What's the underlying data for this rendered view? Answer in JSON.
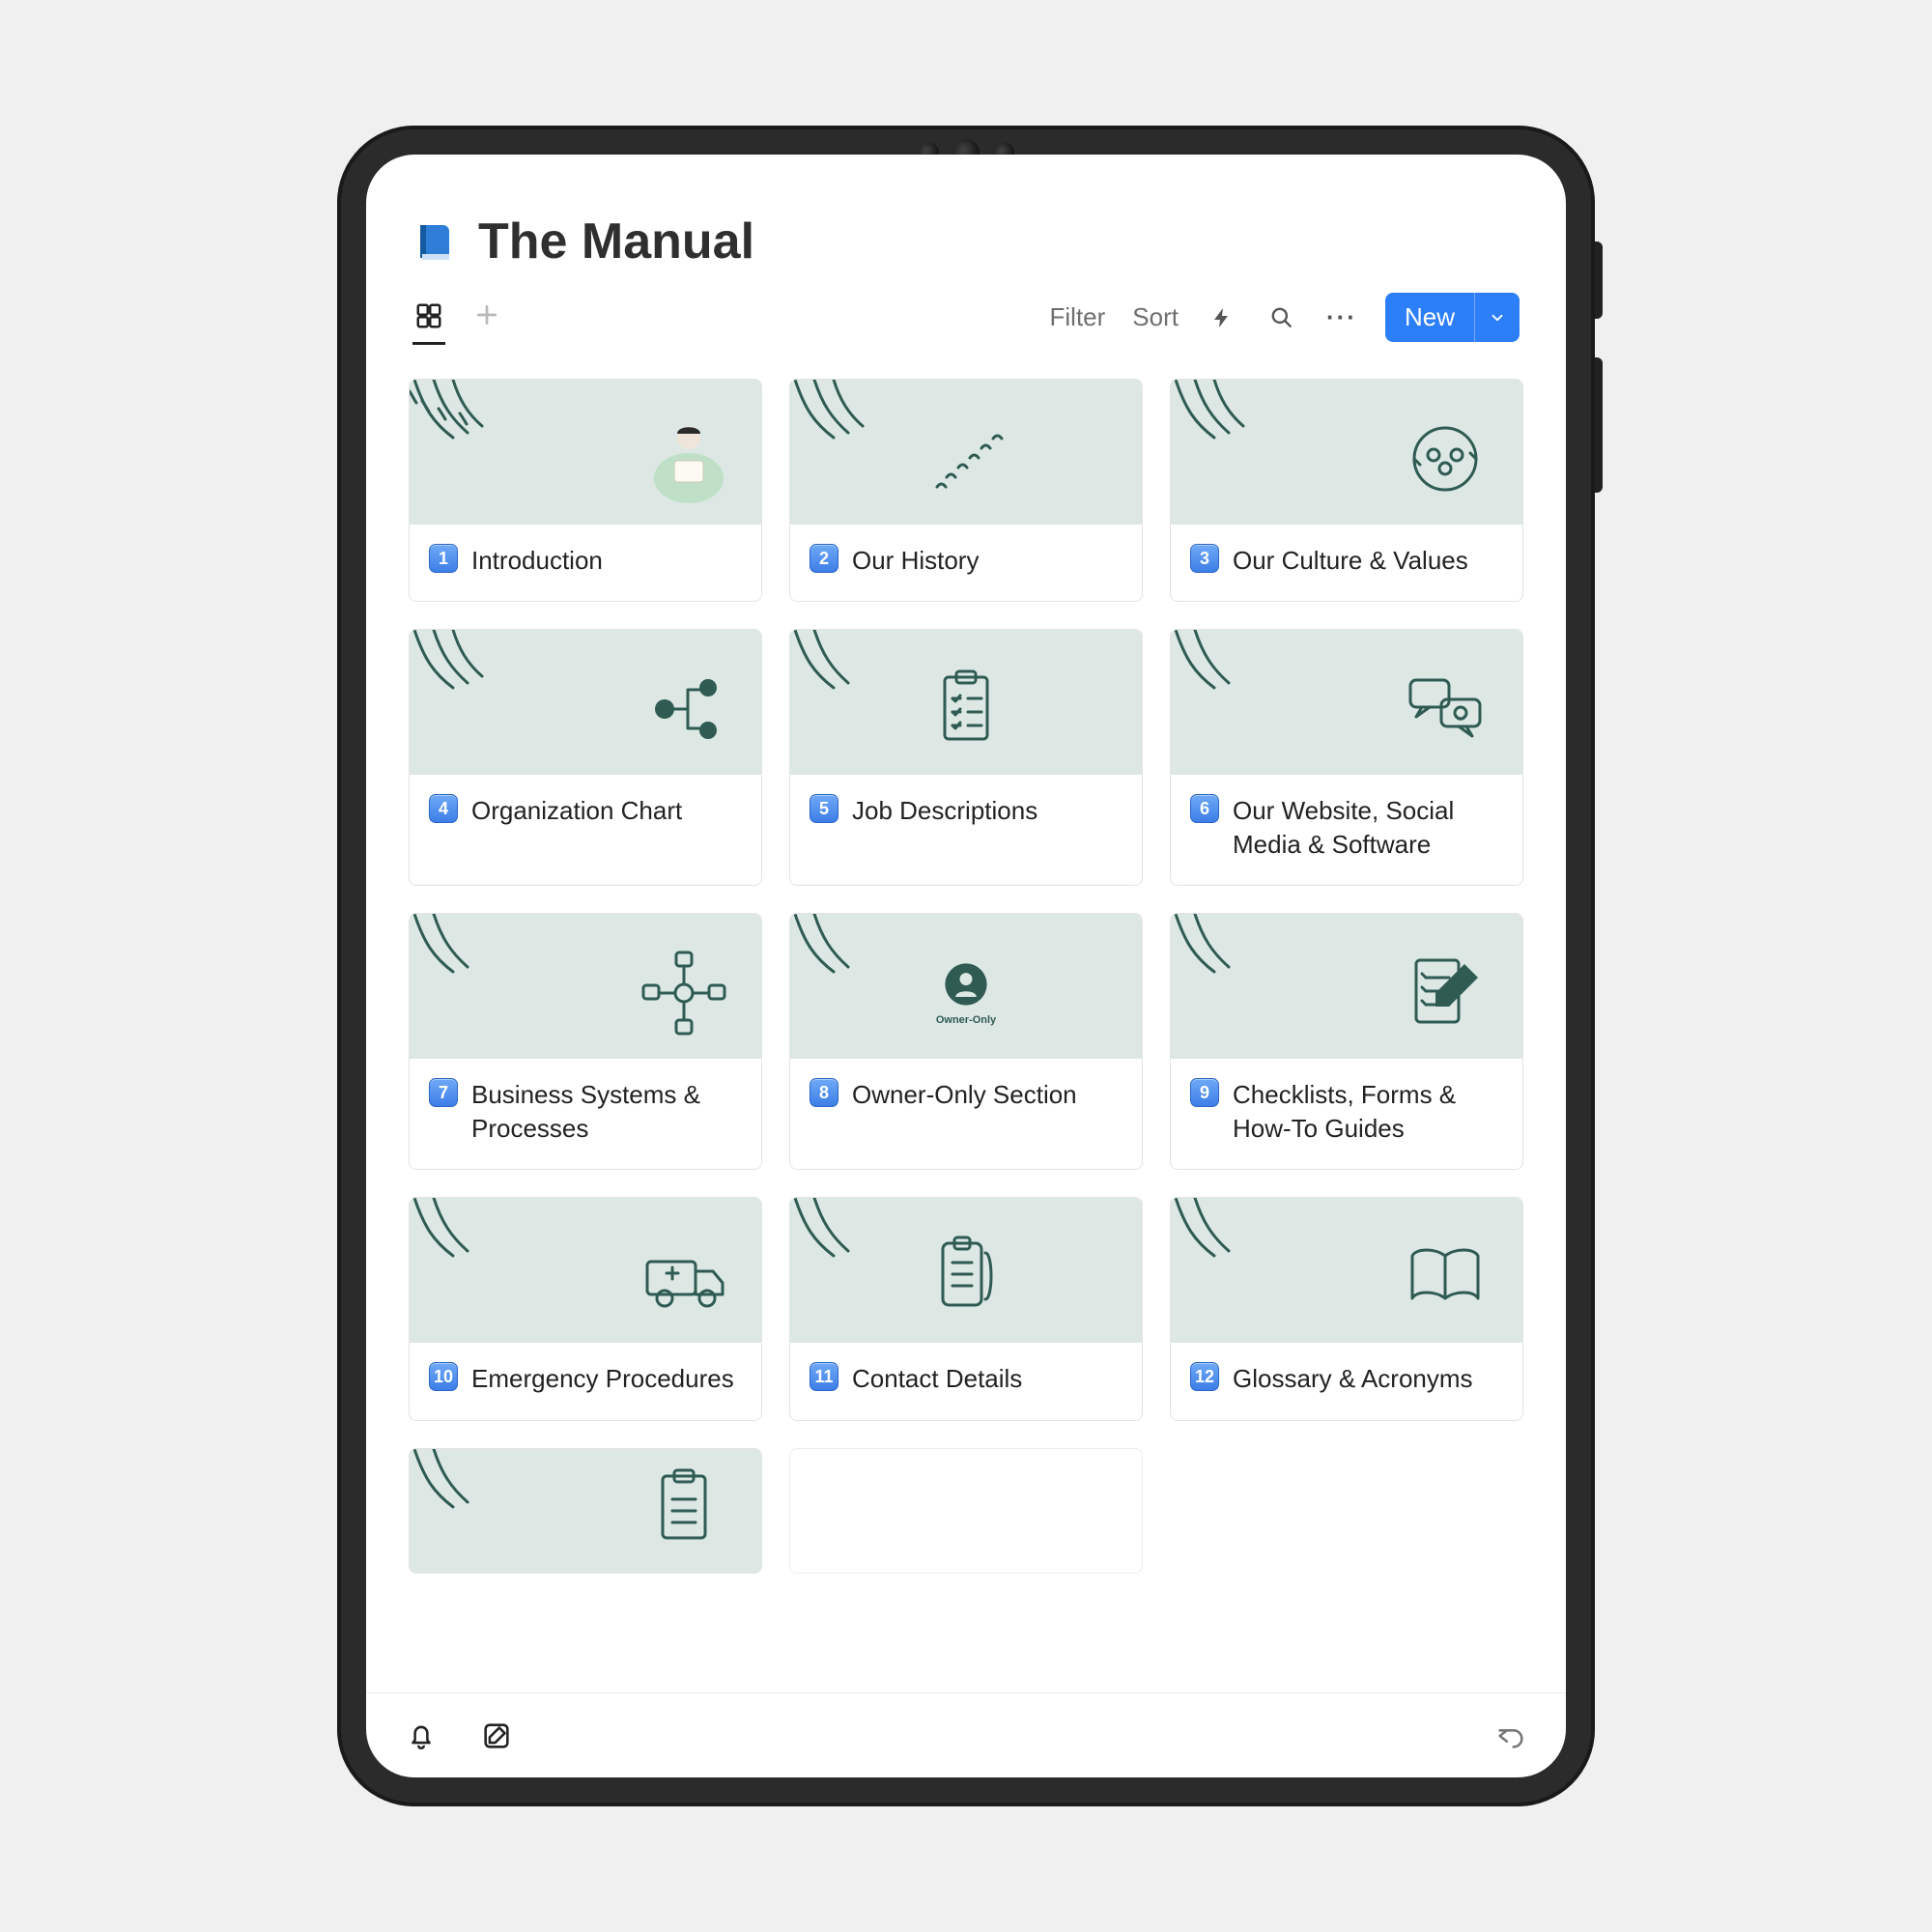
{
  "page_title": "The Manual",
  "toolbar": {
    "filter_label": "Filter",
    "sort_label": "Sort",
    "new_label": "New"
  },
  "cards": [
    {
      "num": "1",
      "title": "Introduction"
    },
    {
      "num": "2",
      "title": "Our History"
    },
    {
      "num": "3",
      "title": "Our Culture & Values"
    },
    {
      "num": "4",
      "title": "Organization Chart"
    },
    {
      "num": "5",
      "title": "Job Descriptions"
    },
    {
      "num": "6",
      "title": "Our Website, Social Media & Software"
    },
    {
      "num": "7",
      "title": "Business Systems & Processes"
    },
    {
      "num": "8",
      "title": "Owner-Only Section",
      "subcaption": "Owner-Only"
    },
    {
      "num": "9",
      "title": "Checklists, Forms & How-To Guides"
    },
    {
      "num": "10",
      "title": "Emergency Procedures"
    },
    {
      "num": "11",
      "title": "Contact Details"
    },
    {
      "num": "12",
      "title": "Glossary & Acronyms"
    }
  ]
}
